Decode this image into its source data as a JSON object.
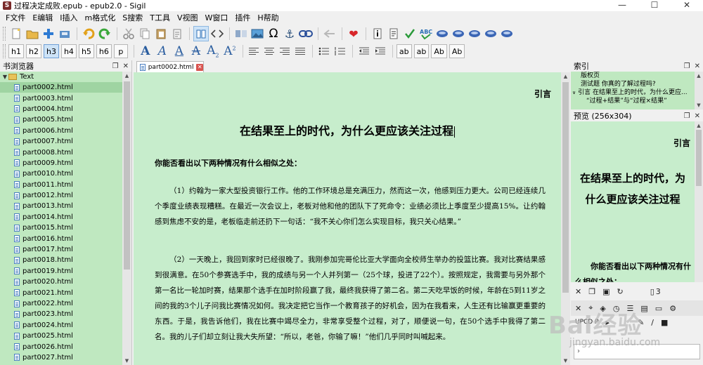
{
  "window": {
    "title": "过程决定成败.epub - epub2.0 - Sigil",
    "app_icon": "S",
    "controls": [
      "—",
      "☐",
      "✕"
    ]
  },
  "menu": [
    "F文件",
    "E编辑",
    "I插入",
    "m格式化",
    "S搜索",
    "T工具",
    "V视图",
    "W窗口",
    "插件",
    "H帮助"
  ],
  "toolbar2": {
    "headings": [
      "h1",
      "h2",
      "h3",
      "h4",
      "h5",
      "h6",
      "p"
    ],
    "selected_heading": "h3",
    "text_buttons": [
      "ab",
      "ab",
      "Ab",
      "Ab"
    ]
  },
  "book_browser": {
    "title": "书浏览器",
    "folder": "Text",
    "files": [
      "part0002.html",
      "part0003.html",
      "part0004.html",
      "part0005.html",
      "part0006.html",
      "part0007.html",
      "part0008.html",
      "part0009.html",
      "part0010.html",
      "part0011.html",
      "part0012.html",
      "part0013.html",
      "part0014.html",
      "part0015.html",
      "part0016.html",
      "part0017.html",
      "part0018.html",
      "part0019.html",
      "part0020.html",
      "part0021.html",
      "part0022.html",
      "part0023.html",
      "part0024.html",
      "part0025.html",
      "part0026.html",
      "part0027.html"
    ],
    "selected_file": "part0002.html"
  },
  "editor": {
    "tab_label": "part0002.html",
    "tag_label": "引言",
    "heading": "在结果至上的时代，为什么更应该关注过程",
    "question": "你能否看出以下两种情况有什么相似之处：",
    "paragraph1": "（1）约翰为一家大型投资银行工作。他的工作环境总是充满压力，然而这一次，他感到压力更大。公司已经连续几个季度业绩表现糟糕。在最近一次会议上，老板对他和他的团队下了死命令：业绩必须比上季度至少提高15%。让约翰感到焦虑不安的是，老板临走前还扔下一句话：“我不关心你们怎么实现目标，我只关心结果。”",
    "paragraph2": "（2）一天晚上，我回到家时已经很晚了。我刚参加完哥伦比亚大学面向全校师生举办的投篮比赛。我对比赛结果感到很满意。在50个参赛选手中，我的成绩与另一个人并列第一（25个球，投进了22个）。按照规定，我需要与另外那个第一名比一轮加时赛，结果那个选手在加时阶段赢了我，最终我获得了第二名。第二天吃早饭的时候，年龄在5到11岁之间的我的3个儿子问我比赛情况如何。我决定把它当作一个教育孩子的好机会，因为在我看来，人生还有比输赢更重要的东西。于是，我告诉他们，我在比赛中竭尽全力，非常享受整个过程，对了，顺便说一句，在50个选手中我得了第二名。我的儿子们却立刻让我大失所望：“所以，老爸，你输了嘛！”他们几乎同时叫喊起来。"
  },
  "index_panel": {
    "title": "索引",
    "items": [
      {
        "text": "版权页",
        "level": 1
      },
      {
        "text": "测试题 你真的了解过程吗?",
        "level": 1
      },
      {
        "text": "引言 在结果至上的时代，为什么更应...",
        "level": 0
      },
      {
        "text": "“过程+结果”与“过程×结果”",
        "level": 1
      }
    ]
  },
  "preview_panel": {
    "title": "预览 (256x304)",
    "tag_label": "引言",
    "heading": "在结果至上的时代，为什么更应该关注过程",
    "question": "你能否看出以下两种情况有什么相似之处："
  },
  "clip_panel": {
    "badge": "3",
    "field_text": "UPCD P"
  },
  "watermark": {
    "text": "Bai经验",
    "url": "jingyan.baidu.com"
  }
}
